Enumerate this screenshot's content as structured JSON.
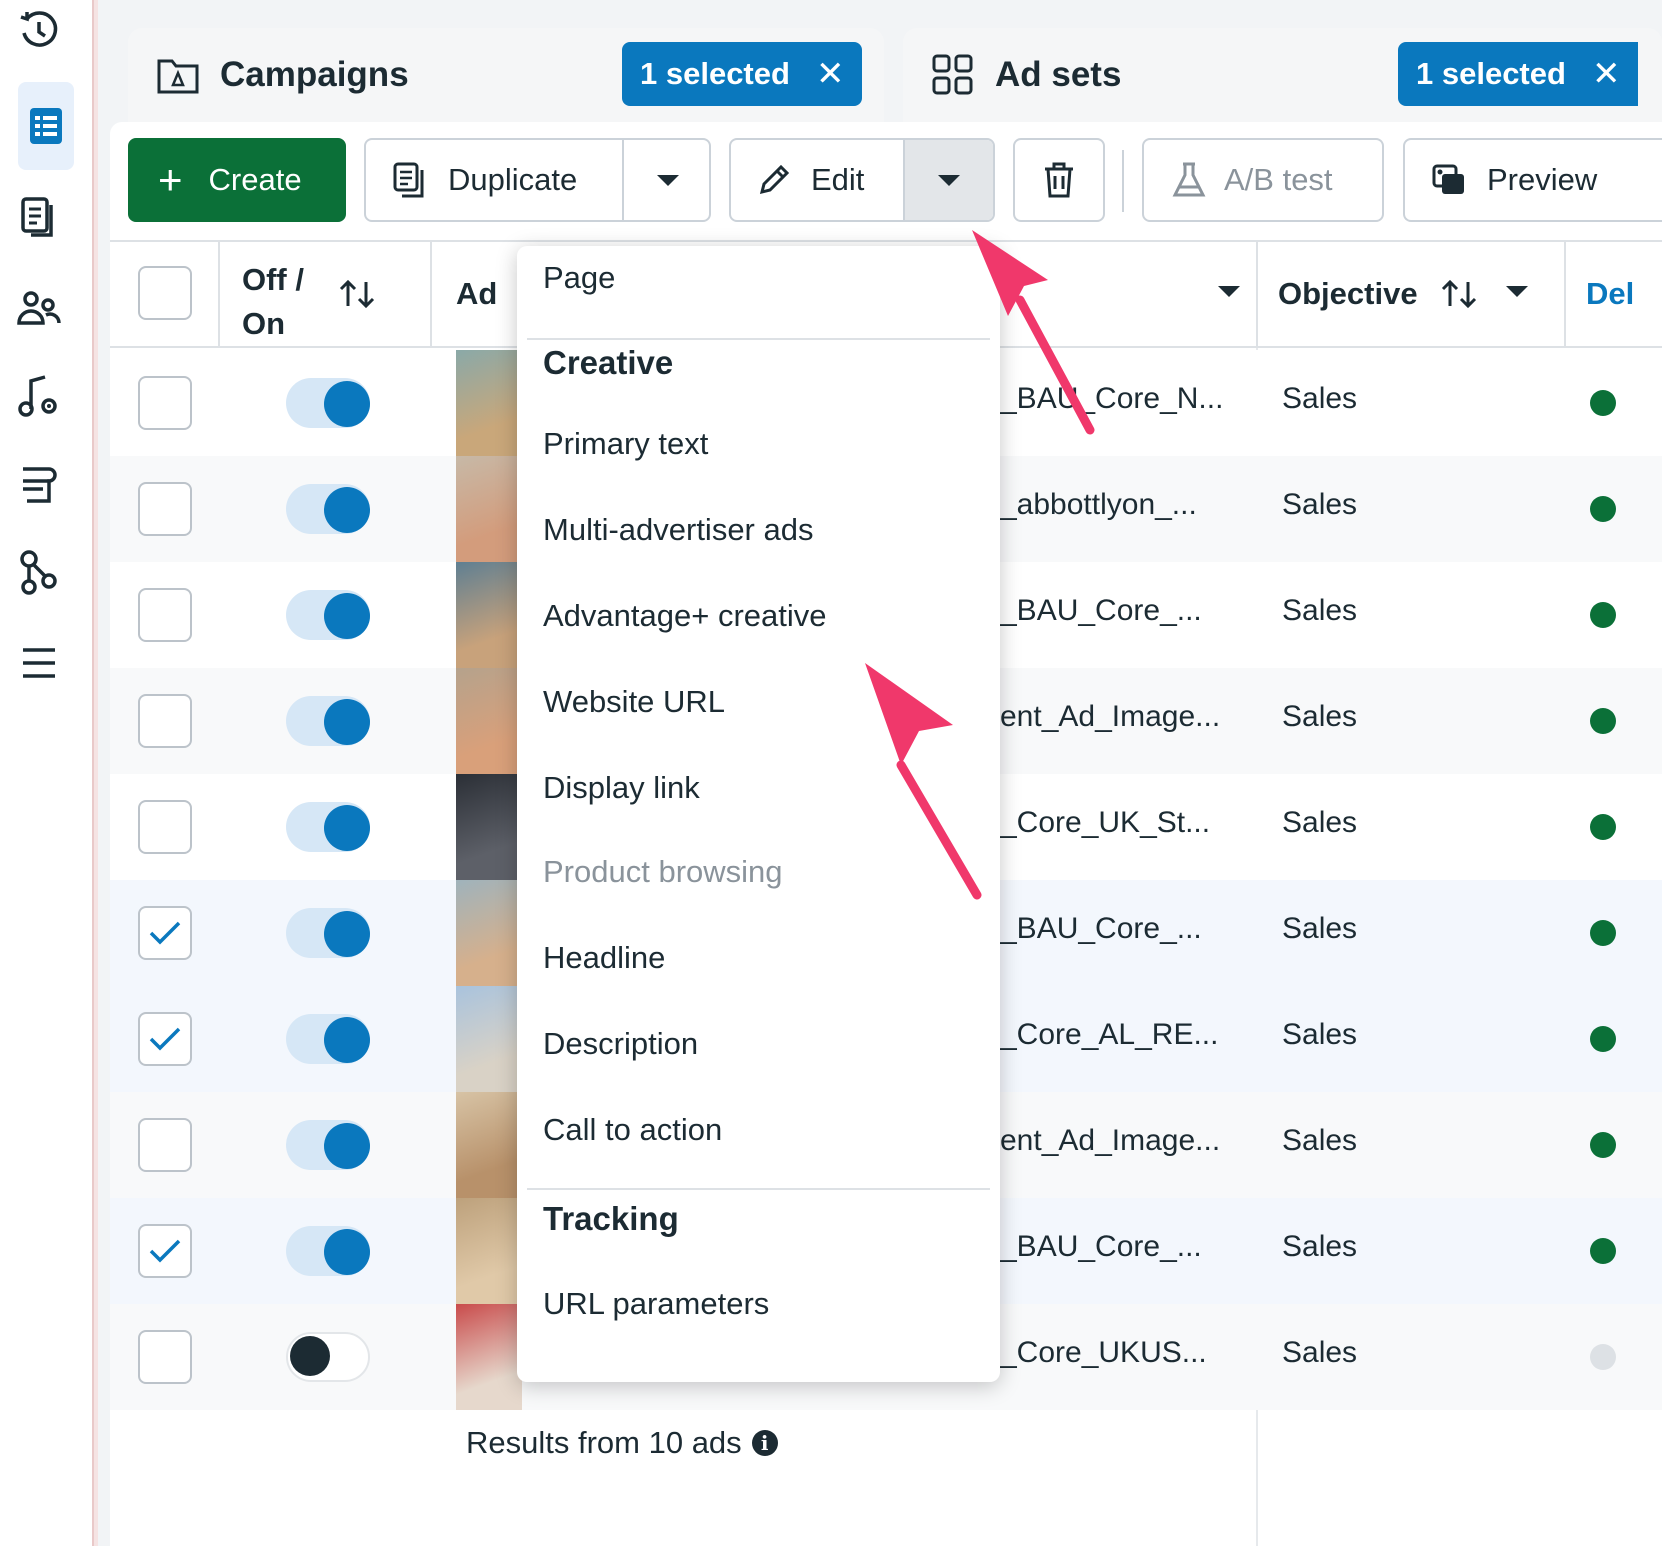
{
  "tabs": {
    "campaigns": {
      "title": "Campaigns",
      "selected_label": "1 selected"
    },
    "adsets": {
      "title": "Ad sets",
      "selected_label": "1 selected"
    }
  },
  "toolbar": {
    "create_label": "Create",
    "duplicate_label": "Duplicate",
    "edit_label": "Edit",
    "ab_test_label": "A/B test",
    "preview_label": "Preview"
  },
  "table": {
    "headers": {
      "off_on_line1": "Off /",
      "off_on_line2": "On",
      "ad": "Ad",
      "objective": "Objective",
      "delivery": "Del"
    },
    "rows": [
      {
        "checked": false,
        "on": true,
        "name": "_BAU_Core_N...",
        "objective": "Sales",
        "delivery_active": true
      },
      {
        "checked": false,
        "on": true,
        "name": "_abbottlyon_...",
        "objective": "Sales",
        "delivery_active": true
      },
      {
        "checked": false,
        "on": true,
        "name": "_BAU_Core_...",
        "objective": "Sales",
        "delivery_active": true
      },
      {
        "checked": false,
        "on": true,
        "name": "ent_Ad_Image...",
        "objective": "Sales",
        "delivery_active": true
      },
      {
        "checked": false,
        "on": true,
        "name": "_Core_UK_St...",
        "objective": "Sales",
        "delivery_active": true
      },
      {
        "checked": true,
        "on": true,
        "name": "_BAU_Core_...",
        "objective": "Sales",
        "delivery_active": true
      },
      {
        "checked": true,
        "on": true,
        "name": "_Core_AL_RE...",
        "objective": "Sales",
        "delivery_active": true
      },
      {
        "checked": false,
        "on": true,
        "name": "ent_Ad_Image...",
        "objective": "Sales",
        "delivery_active": true
      },
      {
        "checked": true,
        "on": true,
        "name": "_BAU_Core_...",
        "objective": "Sales",
        "delivery_active": true
      },
      {
        "checked": false,
        "on": false,
        "name": "_Core_UKUS...",
        "objective": "Sales",
        "delivery_active": false
      }
    ],
    "footer": "Results from 10 ads"
  },
  "menu": {
    "page": "Page",
    "creative_header": "Creative",
    "primary_text": "Primary text",
    "multi_advertiser": "Multi-advertiser ads",
    "advantage_creative": "Advantage+ creative",
    "website_url": "Website URL",
    "display_link": "Display link",
    "product_browsing": "Product browsing",
    "headline": "Headline",
    "description": "Description",
    "call_to_action": "Call to action",
    "tracking_header": "Tracking",
    "url_parameters": "URL parameters"
  },
  "colors": {
    "accent_blue": "#0a78be",
    "create_green": "#0b7038",
    "annotation_pink": "#f0386b",
    "selected_row_bg": "#f3f7fd"
  }
}
